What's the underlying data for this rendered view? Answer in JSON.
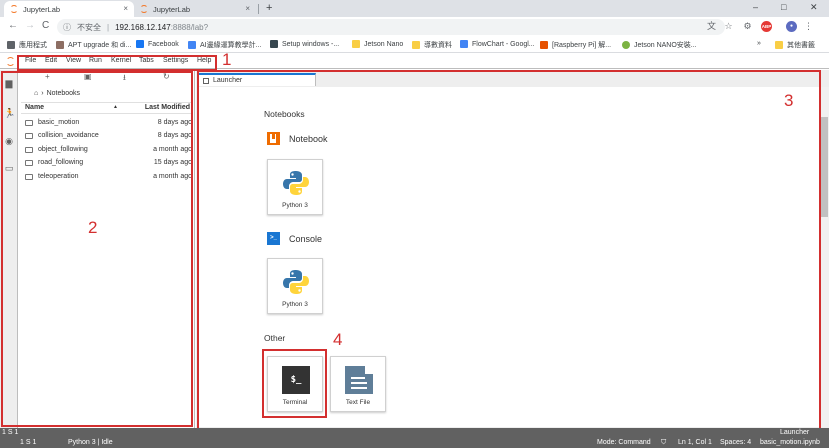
{
  "browser": {
    "tabs": [
      {
        "title": "JupyterLab",
        "close": "×"
      },
      {
        "title": "JupyterLab",
        "close": "×"
      }
    ],
    "new_tab": "+",
    "window_controls": {
      "minimize": "–",
      "maximize": "□",
      "close": "✕"
    },
    "nav": {
      "back": "←",
      "forward": "→",
      "reload": "C"
    },
    "url": {
      "security": "不安全",
      "separator": "|",
      "host": "192.168.12.147",
      "path": ":8888/lab?"
    },
    "bookmarks": [
      {
        "label": "應用程式",
        "icon_color": "#5f6368"
      },
      {
        "label": "APT upgrade 和 di...",
        "icon_color": "#8d6e63"
      },
      {
        "label": "Facebook",
        "icon_color": "#1877f2"
      },
      {
        "label": "AI邊緣運算教學計...",
        "icon_color": "#4285f4"
      },
      {
        "label": "Setup windows -...",
        "icon_color": "#37474f"
      },
      {
        "label": "Jetson Nano",
        "icon_color": "#f9ce45"
      },
      {
        "label": "導數資料",
        "icon_color": "#f9ce45"
      },
      {
        "label": "FlowChart - Googl...",
        "icon_color": "#4285f4"
      },
      {
        "label": "[Raspberry Pi] 解...",
        "icon_color": "#e65100"
      },
      {
        "label": "Jetson NANO安裝...",
        "icon_color": "#7cb342"
      }
    ],
    "bookmarks_more": "»",
    "other_bookmarks": "其他書籤"
  },
  "jupyter": {
    "menu": [
      "File",
      "Edit",
      "View",
      "Run",
      "Kernel",
      "Tabs",
      "Settings",
      "Help"
    ],
    "filebrowser": {
      "toolbar": {
        "new": "+",
        "new_folder": "▣",
        "upload": "⭳",
        "refresh": "↻"
      },
      "breadcrumb_home": "⌂",
      "breadcrumb_sep": "›",
      "breadcrumb": "Notebooks",
      "header_name": "Name",
      "header_sort": "▲",
      "header_modified": "Last Modified",
      "files": [
        {
          "name": "basic_motion",
          "modified": "8 days ago"
        },
        {
          "name": "collision_avoidance",
          "modified": "8 days ago"
        },
        {
          "name": "object_following",
          "modified": "a month ago"
        },
        {
          "name": "road_following",
          "modified": "15 days ago"
        },
        {
          "name": "teleoperation",
          "modified": "a month ago"
        }
      ]
    },
    "launcher": {
      "tab_label": "Launcher",
      "notebooks_title": "Notebooks",
      "notebook_head": "Notebook",
      "notebook_card": "Python 3",
      "console_head": "Console",
      "console_icon": ">_",
      "console_card": "Python 3",
      "other_title": "Other",
      "terminal_card": "Terminal",
      "terminal_icon": "$_",
      "textfile_card": "Text File"
    },
    "statusbar": {
      "left_top": "1  S  1",
      "left_bottom": "1  S  1",
      "kernel": "Python 3 | Idle",
      "launcher_label": "Launcher",
      "mode": "Mode: Command",
      "position": "Ln 1, Col 1",
      "spaces": "Spaces: 4",
      "filename": "basic_motion.ipynb"
    }
  },
  "annotations": [
    "1",
    "2",
    "3",
    "4"
  ],
  "colors": {
    "annotation": "#d32f2f",
    "jupyter_orange": "#f37726",
    "accent_blue": "#1976d2"
  }
}
